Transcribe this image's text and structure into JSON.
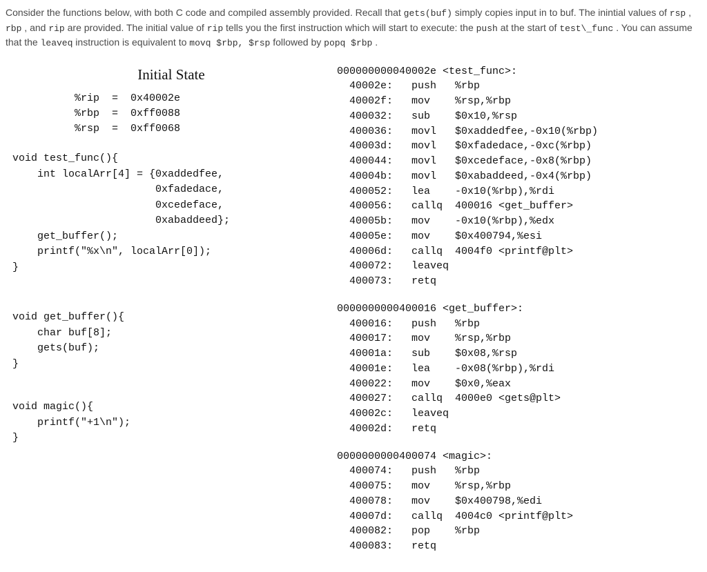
{
  "intro": {
    "p1a": "Consider the functions below, with both C code and compiled assembly provided. Recall that ",
    "p1b": "gets(buf)",
    "p1c": " simply copies input in to buf. The inintial values of ",
    "p1d": "rsp",
    "p1e": ", ",
    "p1f": "rbp",
    "p1g": ", and ",
    "p1h": "rip",
    "p1i": " are provided. The initial value of ",
    "p1j": "rip",
    "p1k": " tells you the first instruction which will start to execute: the ",
    "p1l": "push",
    "p1m": " at the start of ",
    "p1n": "test\\_func",
    "p1o": ". You can assume that the ",
    "p1p": "leaveq",
    "p1q": " instruction is equivalent to ",
    "p1r": "movq $rbp, $rsp",
    "p1s": " followed by ",
    "p1t": "popq $rbp",
    "p1u": "."
  },
  "initial_state": {
    "title": "Initial State",
    "lines": "%rip  =  0x40002e\n%rbp  =  0xff0088\n%rsp  =  0xff0068"
  },
  "ccode": {
    "test_func": "void test_func(){\n    int localArr[4] = {0xaddedfee,\n                       0xfadedace,\n                       0xcedeface,\n                       0xabaddeed};\n    get_buffer();\n    printf(\"%x\\n\", localArr[0]);\n}",
    "get_buffer": "void get_buffer(){\n    char buf[8];\n    gets(buf);\n}",
    "magic": "void magic(){\n    printf(\"+1\\n\");\n}"
  },
  "asm": {
    "test_func": "000000000040002e <test_func>:\n  40002e:   push   %rbp\n  40002f:   mov    %rsp,%rbp\n  400032:   sub    $0x10,%rsp\n  400036:   movl   $0xaddedfee,-0x10(%rbp)\n  40003d:   movl   $0xfadedace,-0xc(%rbp)\n  400044:   movl   $0xcedeface,-0x8(%rbp)\n  40004b:   movl   $0xabaddeed,-0x4(%rbp)\n  400052:   lea    -0x10(%rbp),%rdi\n  400056:   callq  400016 <get_buffer>\n  40005b:   mov    -0x10(%rbp),%edx\n  40005e:   mov    $0x400794,%esi\n  40006d:   callq  4004f0 <printf@plt>\n  400072:   leaveq\n  400073:   retq",
    "get_buffer": "0000000000400016 <get_buffer>:\n  400016:   push   %rbp\n  400017:   mov    %rsp,%rbp\n  40001a:   sub    $0x08,%rsp\n  40001e:   lea    -0x08(%rbp),%rdi\n  400022:   mov    $0x0,%eax\n  400027:   callq  4000e0 <gets@plt>\n  40002c:   leaveq\n  40002d:   retq",
    "magic": "0000000000400074 <magic>:\n  400074:   push   %rbp\n  400075:   mov    %rsp,%rbp\n  400078:   mov    $0x400798,%edi\n  40007d:   callq  4004c0 <printf@plt>\n  400082:   pop    %rbp\n  400083:   retq"
  }
}
